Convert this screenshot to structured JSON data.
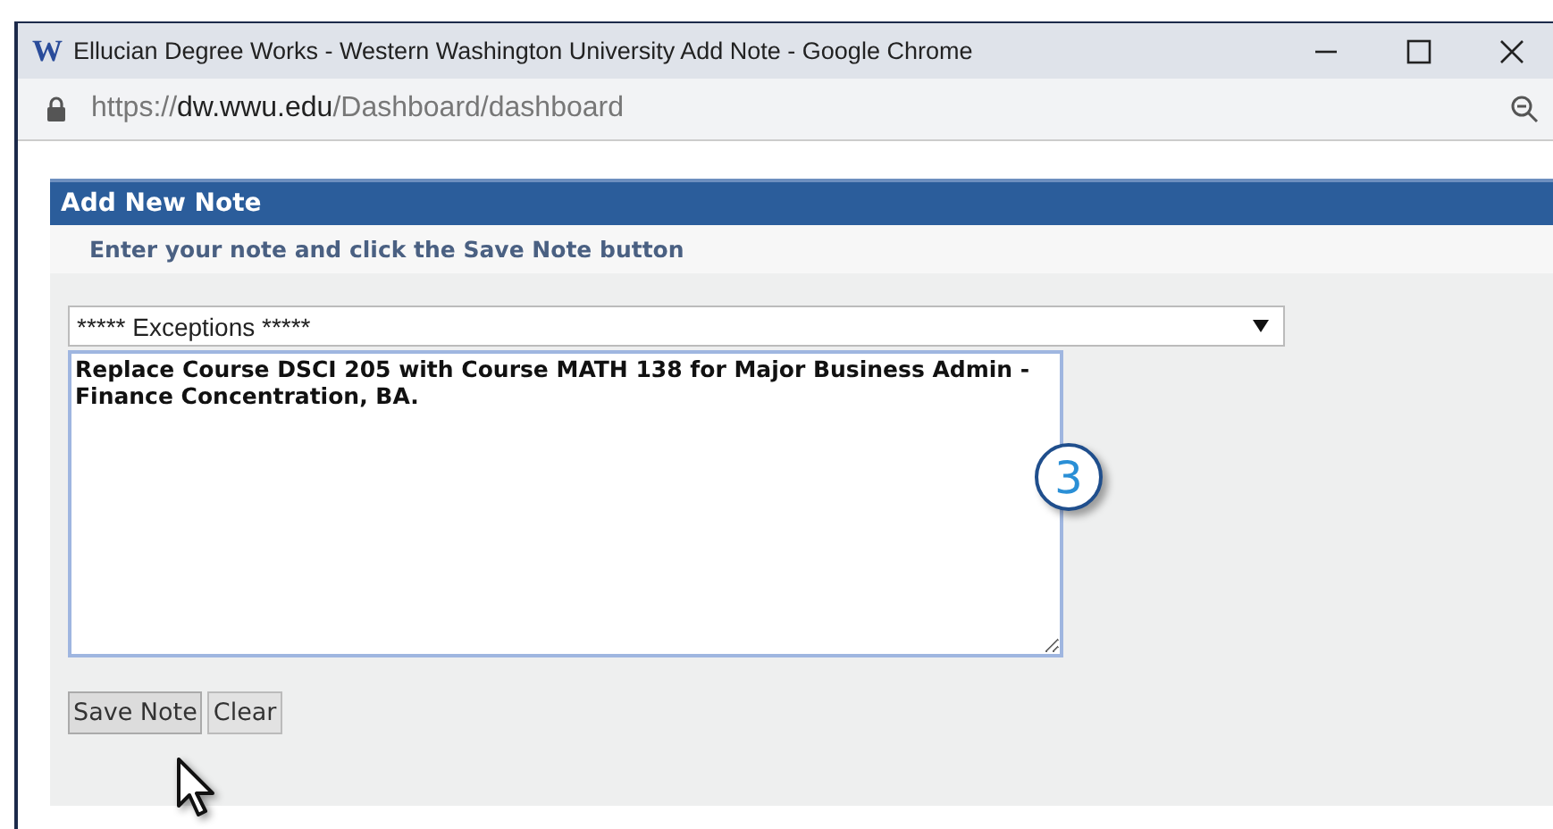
{
  "window": {
    "logo": "W",
    "title": "Ellucian Degree Works - Western Washington University Add Note - Google Chrome"
  },
  "address_bar": {
    "scheme": "https://",
    "host": "dw.wwu.edu",
    "path": "/Dashboard/dashboard"
  },
  "panel": {
    "title": "Add New Note",
    "instructions": "Enter your note and click the Save Note button"
  },
  "note_type": {
    "value": "***** Exceptions *****"
  },
  "note": {
    "value": "Replace Course DSCI 205 with Course MATH 138 for Major Business Admin - Finance Concentration, BA."
  },
  "buttons": [
    {
      "label": "Save Note",
      "hovered": true
    },
    {
      "label": "Clear",
      "hovered": false
    }
  ],
  "callout": {
    "label": "3"
  }
}
